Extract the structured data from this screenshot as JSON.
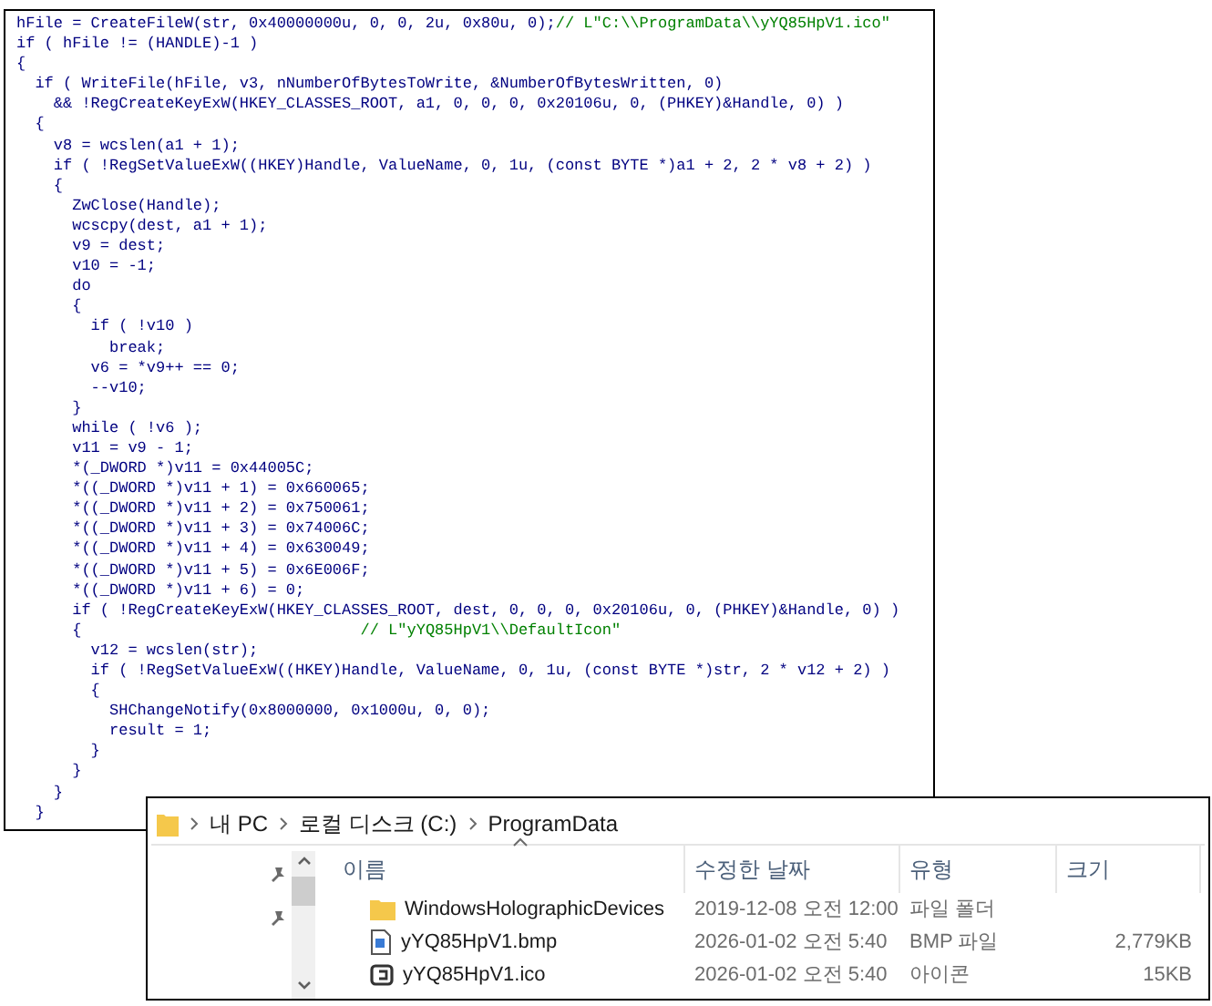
{
  "code_view": {
    "lines": [
      {
        "text": "hFile = CreateFileW(str, 0x40000000u, 0, 0, 2u, 0x80u, 0);",
        "comment": "// L\"C:\\\\ProgramData\\\\yYQ85HpV1.ico\""
      },
      {
        "text": "if ( hFile != (HANDLE)-1 )"
      },
      {
        "text": "{"
      },
      {
        "text": "  if ( WriteFile(hFile, v3, nNumberOfBytesToWrite, &NumberOfBytesWritten, 0)"
      },
      {
        "text": "    && !RegCreateKeyExW(HKEY_CLASSES_ROOT, a1, 0, 0, 0, 0x20106u, 0, (PHKEY)&Handle, 0) )"
      },
      {
        "text": "  {"
      },
      {
        "text": "    v8 = wcslen(a1 + 1);"
      },
      {
        "text": "    if ( !RegSetValueExW((HKEY)Handle, ValueName, 0, 1u, (const BYTE *)a1 + 2, 2 * v8 + 2) )"
      },
      {
        "text": "    {"
      },
      {
        "text": "      ZwClose(Handle);"
      },
      {
        "text": "      wcscpy(dest, a1 + 1);"
      },
      {
        "text": "      v9 = dest;"
      },
      {
        "text": "      v10 = -1;"
      },
      {
        "text": "      do"
      },
      {
        "text": "      {"
      },
      {
        "text": "        if ( !v10 )"
      },
      {
        "text": "          break;"
      },
      {
        "text": "        v6 = *v9++ == 0;"
      },
      {
        "text": "        --v10;"
      },
      {
        "text": "      }"
      },
      {
        "text": "      while ( !v6 );"
      },
      {
        "text": "      v11 = v9 - 1;"
      },
      {
        "text": "      *(_DWORD *)v11 = 0x44005C;"
      },
      {
        "text": "      *((_DWORD *)v11 + 1) = 0x660065;"
      },
      {
        "text": "      *((_DWORD *)v11 + 2) = 0x750061;"
      },
      {
        "text": "      *((_DWORD *)v11 + 3) = 0x74006C;"
      },
      {
        "text": "      *((_DWORD *)v11 + 4) = 0x630049;"
      },
      {
        "text": "      *((_DWORD *)v11 + 5) = 0x6E006F;"
      },
      {
        "text": "      *((_DWORD *)v11 + 6) = 0;"
      },
      {
        "text": "      if ( !RegCreateKeyExW(HKEY_CLASSES_ROOT, dest, 0, 0, 0, 0x20106u, 0, (PHKEY)&Handle, 0) )"
      },
      {
        "text": "      {                              ",
        "comment": "// L\"yYQ85HpV1\\\\DefaultIcon\""
      },
      {
        "text": "        v12 = wcslen(str);"
      },
      {
        "text": "        if ( !RegSetValueExW((HKEY)Handle, ValueName, 0, 1u, (const BYTE *)str, 2 * v12 + 2) )"
      },
      {
        "text": "        {"
      },
      {
        "text": "          SHChangeNotify(0x8000000, 0x1000u, 0, 0);"
      },
      {
        "text": "          result = 1;"
      },
      {
        "text": "        }"
      },
      {
        "text": "      }"
      },
      {
        "text": "    }"
      },
      {
        "text": "  }"
      }
    ]
  },
  "explorer": {
    "breadcrumb": [
      "내 PC",
      "로컬 디스크 (C:)",
      "ProgramData"
    ],
    "columns": [
      {
        "label": "이름",
        "sorted": true
      },
      {
        "label": "수정한 날짜",
        "sorted": false
      },
      {
        "label": "유형",
        "sorted": false
      },
      {
        "label": "크기",
        "sorted": false
      }
    ],
    "rows": [
      {
        "kind": "folder",
        "name": "WindowsHolographicDevices",
        "date": "2019-12-08 오전 12:00",
        "type": "파일 폴더"
      },
      {
        "kind": "bitmap",
        "name": "yYQ85HpV1.bmp",
        "date": "2026-01-02 오전 5:40",
        "type": "BMP 파일",
        "size": "2,779KB"
      },
      {
        "kind": "icon",
        "name": "yYQ85HpV1.ico",
        "date": "2026-01-02 오전 5:40",
        "type": "아이콘",
        "size": "15KB"
      }
    ]
  }
}
